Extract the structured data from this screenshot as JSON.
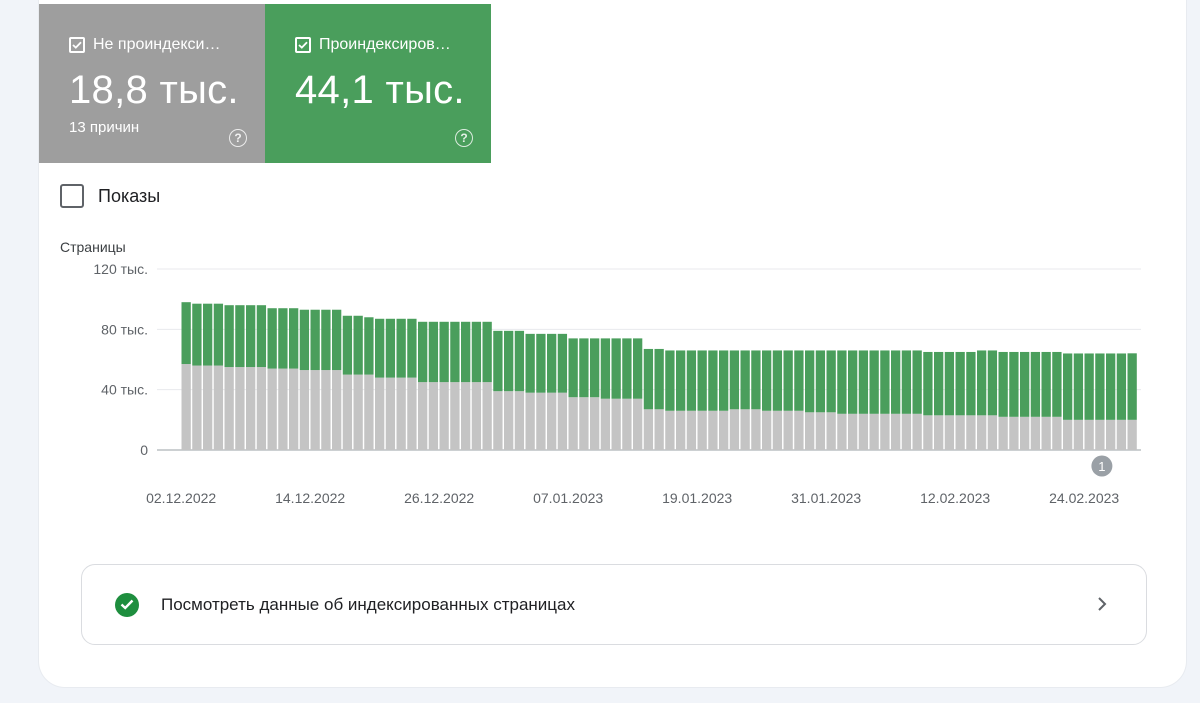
{
  "tiles": [
    {
      "label": "Не проиндекси…",
      "value": "18,8 тыс.",
      "sub": "13 причин",
      "color": "#9e9e9e",
      "checked": true
    },
    {
      "label": "Проиндексиров…",
      "value": "44,1 тыс.",
      "sub": "",
      "color": "#4a9e5c",
      "checked": true
    }
  ],
  "shows": {
    "label": "Показы",
    "checked": false
  },
  "chart_data": {
    "type": "bar",
    "stacked": true,
    "ylabel": "Страницы",
    "ylim": [
      0,
      120000
    ],
    "y_ticks": [
      {
        "value": 0,
        "label": "0"
      },
      {
        "value": 40000,
        "label": "40 тыс."
      },
      {
        "value": 80000,
        "label": "80 тыс."
      },
      {
        "value": 120000,
        "label": "120 тыс."
      }
    ],
    "x_tick_labels": [
      {
        "index": 0,
        "label": "02.12.2022"
      },
      {
        "index": 12,
        "label": "14.12.2022"
      },
      {
        "index": 24,
        "label": "26.12.2022"
      },
      {
        "index": 36,
        "label": "07.01.2023"
      },
      {
        "index": 48,
        "label": "19.01.2023"
      },
      {
        "index": 60,
        "label": "31.01.2023"
      },
      {
        "index": 72,
        "label": "12.02.2023"
      },
      {
        "index": 84,
        "label": "24.02.2023"
      }
    ],
    "annotation": {
      "index": 85,
      "label": "1"
    },
    "series": [
      {
        "name": "Не проиндекси…",
        "color": "#c4c4c4",
        "values": [
          57000,
          56000,
          56000,
          56000,
          55000,
          55000,
          55000,
          55000,
          54000,
          54000,
          54000,
          53000,
          53000,
          53000,
          53000,
          50000,
          50000,
          50000,
          48000,
          48000,
          48000,
          48000,
          45000,
          45000,
          45000,
          45000,
          45000,
          45000,
          45000,
          39000,
          39000,
          39000,
          38000,
          38000,
          38000,
          38000,
          35000,
          35000,
          35000,
          34000,
          34000,
          34000,
          34000,
          27000,
          27000,
          26000,
          26000,
          26000,
          26000,
          26000,
          26000,
          27000,
          27000,
          27000,
          26000,
          26000,
          26000,
          26000,
          25000,
          25000,
          25000,
          24000,
          24000,
          24000,
          24000,
          24000,
          24000,
          24000,
          24000,
          23000,
          23000,
          23000,
          23000,
          23000,
          23000,
          23000,
          22000,
          22000,
          22000,
          22000,
          22000,
          22000,
          20000,
          20000,
          20000,
          20000,
          20000,
          20000,
          20000
        ]
      },
      {
        "name": "Проиндексиров…",
        "color": "#4a9e5c",
        "values": [
          41000,
          41000,
          41000,
          41000,
          41000,
          41000,
          41000,
          41000,
          40000,
          40000,
          40000,
          40000,
          40000,
          40000,
          40000,
          39000,
          39000,
          38000,
          39000,
          39000,
          39000,
          39000,
          40000,
          40000,
          40000,
          40000,
          40000,
          40000,
          40000,
          40000,
          40000,
          40000,
          39000,
          39000,
          39000,
          39000,
          39000,
          39000,
          39000,
          40000,
          40000,
          40000,
          40000,
          40000,
          40000,
          40000,
          40000,
          40000,
          40000,
          40000,
          40000,
          39000,
          39000,
          39000,
          40000,
          40000,
          40000,
          40000,
          41000,
          41000,
          41000,
          42000,
          42000,
          42000,
          42000,
          42000,
          42000,
          42000,
          42000,
          42000,
          42000,
          42000,
          42000,
          42000,
          43000,
          43000,
          43000,
          43000,
          43000,
          43000,
          43000,
          43000,
          44000,
          44000,
          44000,
          44000,
          44000,
          44000,
          44100
        ]
      }
    ]
  },
  "footer_link": {
    "label": "Посмотреть данные об индексированных страницах"
  }
}
